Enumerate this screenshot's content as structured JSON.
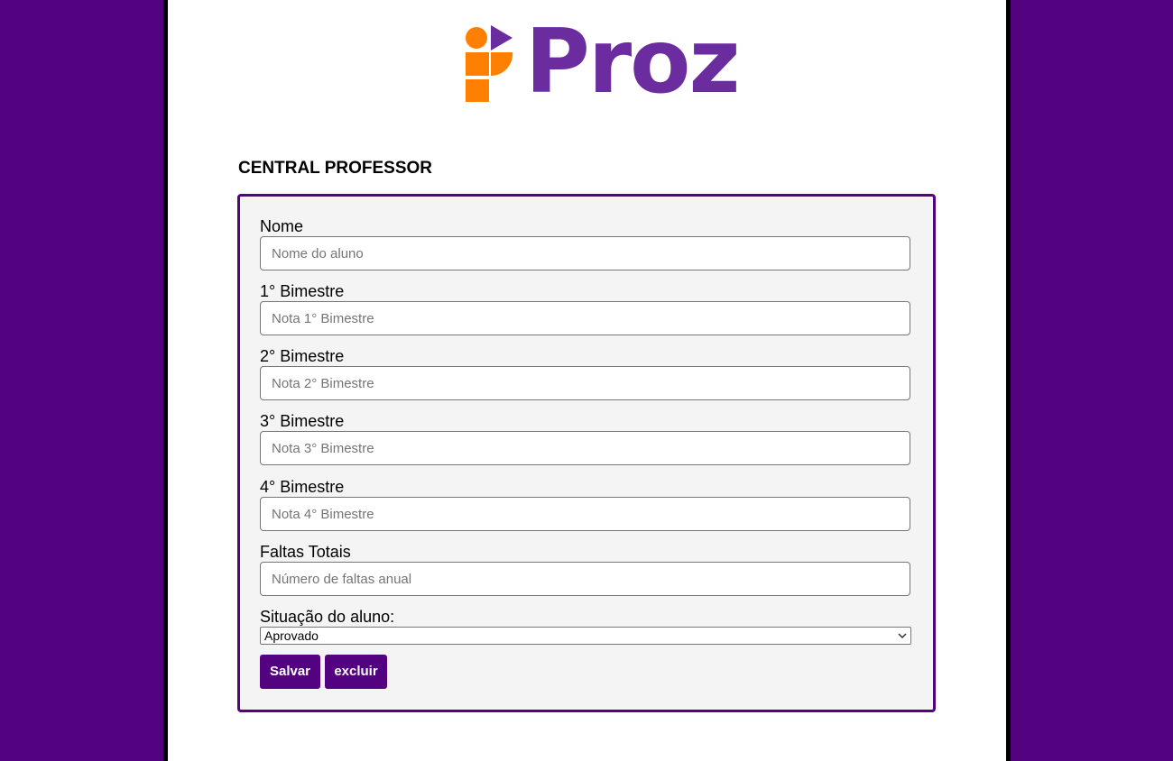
{
  "brand": {
    "name": "Proz",
    "colors": {
      "primary": "#530380",
      "logo_purple": "#6a2c9e",
      "logo_orange": "#ff7f00"
    }
  },
  "page_title": "CENTRAL PROFESSOR",
  "form": {
    "fields": [
      {
        "label": "Nome",
        "placeholder": "Nome do aluno",
        "value": ""
      },
      {
        "label": "1° Bimestre",
        "placeholder": "Nota 1° Bimestre",
        "value": ""
      },
      {
        "label": "2° Bimestre",
        "placeholder": "Nota 2° Bimestre",
        "value": ""
      },
      {
        "label": "3° Bimestre",
        "placeholder": "Nota 3° Bimestre",
        "value": ""
      },
      {
        "label": "4° Bimestre",
        "placeholder": "Nota 4° Bimestre",
        "value": ""
      },
      {
        "label": "Faltas Totais",
        "placeholder": "Número de faltas anual",
        "value": ""
      }
    ],
    "status": {
      "label": "Situação do aluno:",
      "selected": "Aprovado",
      "icon": "chevron-down-icon"
    },
    "buttons": {
      "save": "Salvar",
      "delete": "excluir"
    }
  }
}
